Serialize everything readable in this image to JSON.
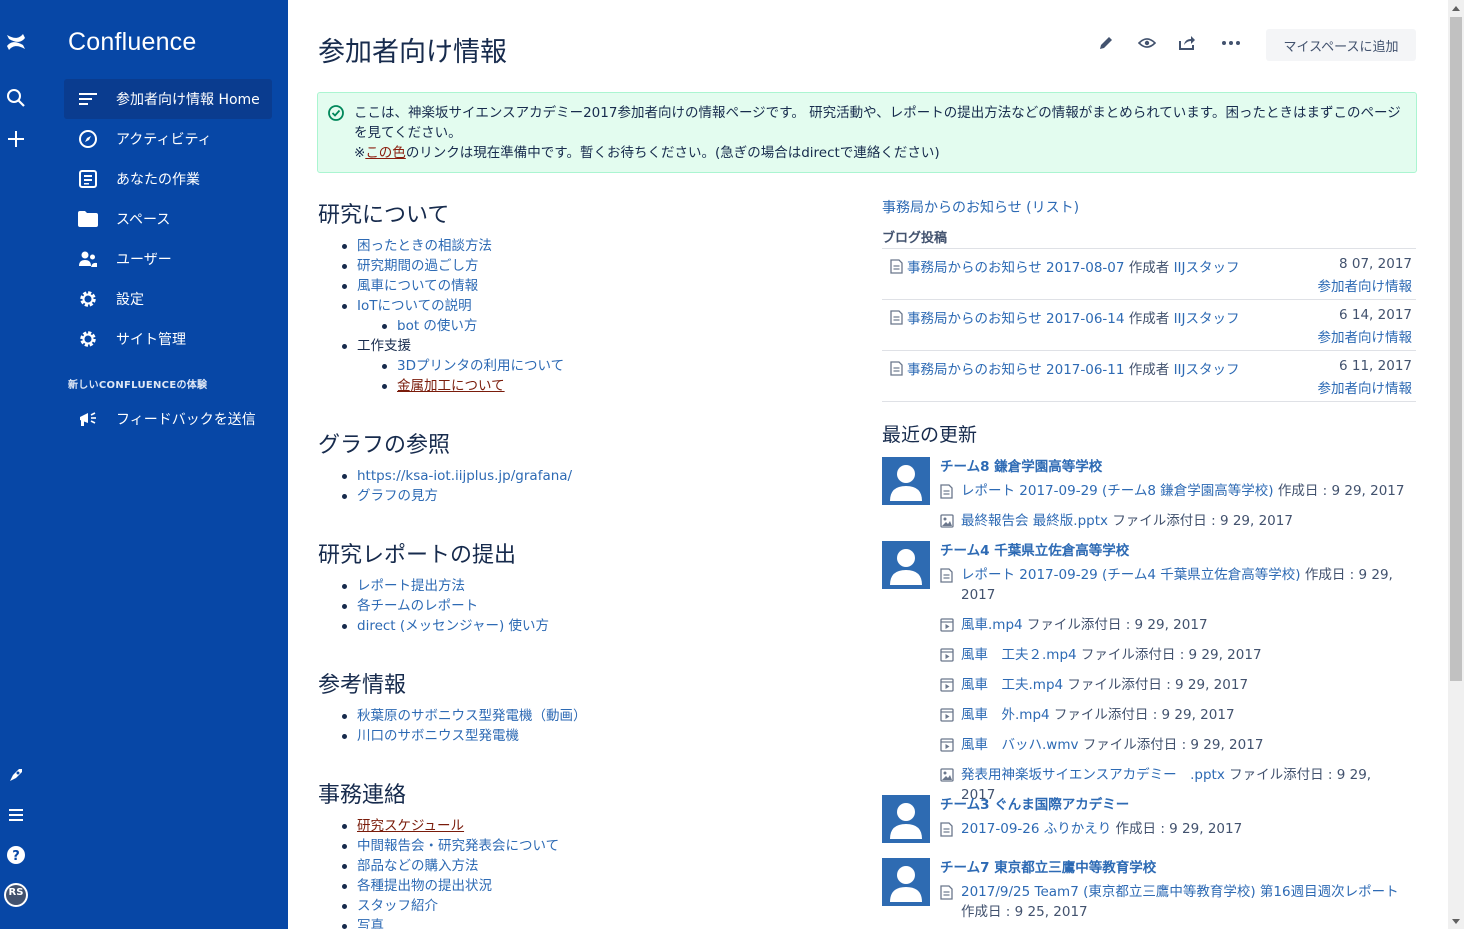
{
  "rail": {
    "avatar_initials": "RS"
  },
  "side": {
    "product": "Confluence",
    "items": [
      {
        "label": "参加者向け情報 Home",
        "icon": "page-tree-icon"
      },
      {
        "label": "アクティビティ",
        "icon": "compass-icon"
      },
      {
        "label": "あなたの作業",
        "icon": "document-icon"
      },
      {
        "label": "スペース",
        "icon": "folder-icon"
      },
      {
        "label": "ユーザー",
        "icon": "people-icon"
      },
      {
        "label": "設定",
        "icon": "gear-icon"
      },
      {
        "label": "サイト管理",
        "icon": "gear-icon"
      }
    ],
    "section_heading": "新しいCONFLUENCEの体験",
    "feedback": "フィードバックを送信"
  },
  "page": {
    "title": "参加者向け情報",
    "add_to_myspace": "マイスペースに追加",
    "info": {
      "line1": "ここは、神楽坂サイエンスアカデミー2017参加者向けの情報ページです。 研究活動や、レポートの提出方法などの情報がまとめられています。困ったときはまずこのページを見てください。",
      "note_prefix": "※",
      "note_colored": "この色",
      "note_suffix": "のリンクは現在準備中です。暫くお待ちください。(急ぎの場合はdirectで連絡ください)"
    },
    "sections": {
      "research": {
        "title": "研究について",
        "items": [
          "困ったときの相談方法",
          "研究期間の過ごし方",
          "風車についての情報",
          "IoTについての説明",
          "bot の使い方",
          "工作支援",
          "3Dプリンタの利用について",
          "金属加工について"
        ]
      },
      "graph": {
        "title": "グラフの参照",
        "items": [
          "https://ksa-iot.iijplus.jp/grafana/",
          "グラフの見方"
        ]
      },
      "report": {
        "title": "研究レポートの提出",
        "items": [
          "レポート提出方法",
          "各チームのレポート",
          "direct (メッセンジャー) 使い方"
        ]
      },
      "reference": {
        "title": "参考情報",
        "items": [
          "秋葉原のサボニウス型発電機（動画）",
          "川口のサボニウス型発電機"
        ]
      },
      "office": {
        "title": "事務連絡",
        "items": [
          "研究スケジュール",
          "中間報告会・研究発表会について",
          "部品などの購入方法",
          "各種提出物の提出状況",
          "スタッフ紹介",
          "写真"
        ]
      }
    },
    "news": {
      "link": "事務局からのお知らせ (リスト)",
      "blog_heading": "ブログ投稿",
      "posts": [
        {
          "title": "事務局からのお知らせ 2017-08-07",
          "by": "作成者",
          "author": "IIJスタッフ",
          "date": "8 07, 2017",
          "space": "参加者向け情報"
        },
        {
          "title": "事務局からのお知らせ 2017-06-14",
          "by": "作成者",
          "author": "IIJスタッフ",
          "date": "6 14, 2017",
          "space": "参加者向け情報"
        },
        {
          "title": "事務局からのお知らせ 2017-06-11",
          "by": "作成者",
          "author": "IIJスタッフ",
          "date": "6 11, 2017",
          "space": "参加者向け情報"
        }
      ]
    },
    "recent": {
      "heading": "最近の更新",
      "groups": [
        {
          "team": "チーム8 鎌倉学園高等学校",
          "updates": [
            {
              "title": "レポート 2017-09-29 (チーム8 鎌倉学園高等学校)",
              "meta": "作成日 : 9 29, 2017",
              "icon": "page-icon"
            },
            {
              "title": "最終報告会 最終版.pptx",
              "meta": "ファイル添付日 : 9 29, 2017",
              "icon": "image-file-icon"
            }
          ]
        },
        {
          "team": "チーム4 千葉県立佐倉高等学校",
          "updates": [
            {
              "title": "レポート 2017-09-29 (チーム4 千葉県立佐倉高等学校)",
              "meta": "作成日 : 9 29, 2017",
              "icon": "page-icon"
            },
            {
              "title": "風車.mp4",
              "meta": "ファイル添付日 : 9 29, 2017",
              "icon": "video-file-icon"
            },
            {
              "title": "風車　工夫２.mp4",
              "meta": "ファイル添付日 : 9 29, 2017",
              "icon": "video-file-icon"
            },
            {
              "title": "風車　工夫.mp4",
              "meta": "ファイル添付日 : 9 29, 2017",
              "icon": "video-file-icon"
            },
            {
              "title": "風車　外.mp4",
              "meta": "ファイル添付日 : 9 29, 2017",
              "icon": "video-file-icon"
            },
            {
              "title": "風車　バッハ.wmv",
              "meta": "ファイル添付日 : 9 29, 2017",
              "icon": "video-file-icon"
            },
            {
              "title": "発表用神楽坂サイエンスアカデミー　.pptx",
              "meta": "ファイル添付日 : 9 29, 2017",
              "icon": "image-file-icon"
            }
          ]
        },
        {
          "team": "チーム3 ぐんま国際アカデミー",
          "updates": [
            {
              "title": "2017-09-26 ふりかえり",
              "meta": "作成日 : 9 29, 2017",
              "icon": "page-icon"
            }
          ]
        },
        {
          "team": "チーム7 東京都立三鷹中等教育学校",
          "updates": [
            {
              "title": "2017/9/25 Team7 (東京都立三鷹中等教育学校) 第16週目週次レポート",
              "meta": "作成日 : 9 25, 2017",
              "icon": "page-icon"
            }
          ]
        }
      ]
    }
  }
}
